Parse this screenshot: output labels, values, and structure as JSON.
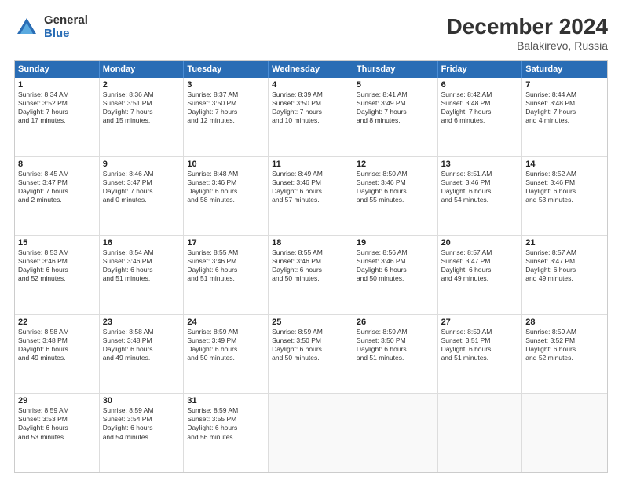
{
  "logo": {
    "general": "General",
    "blue": "Blue"
  },
  "title": "December 2024",
  "subtitle": "Balakirevo, Russia",
  "weekdays": [
    "Sunday",
    "Monday",
    "Tuesday",
    "Wednesday",
    "Thursday",
    "Friday",
    "Saturday"
  ],
  "weeks": [
    [
      {
        "day": "1",
        "text": "Sunrise: 8:34 AM\nSunset: 3:52 PM\nDaylight: 7 hours\nand 17 minutes."
      },
      {
        "day": "2",
        "text": "Sunrise: 8:36 AM\nSunset: 3:51 PM\nDaylight: 7 hours\nand 15 minutes."
      },
      {
        "day": "3",
        "text": "Sunrise: 8:37 AM\nSunset: 3:50 PM\nDaylight: 7 hours\nand 12 minutes."
      },
      {
        "day": "4",
        "text": "Sunrise: 8:39 AM\nSunset: 3:50 PM\nDaylight: 7 hours\nand 10 minutes."
      },
      {
        "day": "5",
        "text": "Sunrise: 8:41 AM\nSunset: 3:49 PM\nDaylight: 7 hours\nand 8 minutes."
      },
      {
        "day": "6",
        "text": "Sunrise: 8:42 AM\nSunset: 3:48 PM\nDaylight: 7 hours\nand 6 minutes."
      },
      {
        "day": "7",
        "text": "Sunrise: 8:44 AM\nSunset: 3:48 PM\nDaylight: 7 hours\nand 4 minutes."
      }
    ],
    [
      {
        "day": "8",
        "text": "Sunrise: 8:45 AM\nSunset: 3:47 PM\nDaylight: 7 hours\nand 2 minutes."
      },
      {
        "day": "9",
        "text": "Sunrise: 8:46 AM\nSunset: 3:47 PM\nDaylight: 7 hours\nand 0 minutes."
      },
      {
        "day": "10",
        "text": "Sunrise: 8:48 AM\nSunset: 3:46 PM\nDaylight: 6 hours\nand 58 minutes."
      },
      {
        "day": "11",
        "text": "Sunrise: 8:49 AM\nSunset: 3:46 PM\nDaylight: 6 hours\nand 57 minutes."
      },
      {
        "day": "12",
        "text": "Sunrise: 8:50 AM\nSunset: 3:46 PM\nDaylight: 6 hours\nand 55 minutes."
      },
      {
        "day": "13",
        "text": "Sunrise: 8:51 AM\nSunset: 3:46 PM\nDaylight: 6 hours\nand 54 minutes."
      },
      {
        "day": "14",
        "text": "Sunrise: 8:52 AM\nSunset: 3:46 PM\nDaylight: 6 hours\nand 53 minutes."
      }
    ],
    [
      {
        "day": "15",
        "text": "Sunrise: 8:53 AM\nSunset: 3:46 PM\nDaylight: 6 hours\nand 52 minutes."
      },
      {
        "day": "16",
        "text": "Sunrise: 8:54 AM\nSunset: 3:46 PM\nDaylight: 6 hours\nand 51 minutes."
      },
      {
        "day": "17",
        "text": "Sunrise: 8:55 AM\nSunset: 3:46 PM\nDaylight: 6 hours\nand 51 minutes."
      },
      {
        "day": "18",
        "text": "Sunrise: 8:55 AM\nSunset: 3:46 PM\nDaylight: 6 hours\nand 50 minutes."
      },
      {
        "day": "19",
        "text": "Sunrise: 8:56 AM\nSunset: 3:46 PM\nDaylight: 6 hours\nand 50 minutes."
      },
      {
        "day": "20",
        "text": "Sunrise: 8:57 AM\nSunset: 3:47 PM\nDaylight: 6 hours\nand 49 minutes."
      },
      {
        "day": "21",
        "text": "Sunrise: 8:57 AM\nSunset: 3:47 PM\nDaylight: 6 hours\nand 49 minutes."
      }
    ],
    [
      {
        "day": "22",
        "text": "Sunrise: 8:58 AM\nSunset: 3:48 PM\nDaylight: 6 hours\nand 49 minutes."
      },
      {
        "day": "23",
        "text": "Sunrise: 8:58 AM\nSunset: 3:48 PM\nDaylight: 6 hours\nand 49 minutes."
      },
      {
        "day": "24",
        "text": "Sunrise: 8:59 AM\nSunset: 3:49 PM\nDaylight: 6 hours\nand 50 minutes."
      },
      {
        "day": "25",
        "text": "Sunrise: 8:59 AM\nSunset: 3:50 PM\nDaylight: 6 hours\nand 50 minutes."
      },
      {
        "day": "26",
        "text": "Sunrise: 8:59 AM\nSunset: 3:50 PM\nDaylight: 6 hours\nand 51 minutes."
      },
      {
        "day": "27",
        "text": "Sunrise: 8:59 AM\nSunset: 3:51 PM\nDaylight: 6 hours\nand 51 minutes."
      },
      {
        "day": "28",
        "text": "Sunrise: 8:59 AM\nSunset: 3:52 PM\nDaylight: 6 hours\nand 52 minutes."
      }
    ],
    [
      {
        "day": "29",
        "text": "Sunrise: 8:59 AM\nSunset: 3:53 PM\nDaylight: 6 hours\nand 53 minutes."
      },
      {
        "day": "30",
        "text": "Sunrise: 8:59 AM\nSunset: 3:54 PM\nDaylight: 6 hours\nand 54 minutes."
      },
      {
        "day": "31",
        "text": "Sunrise: 8:59 AM\nSunset: 3:55 PM\nDaylight: 6 hours\nand 56 minutes."
      },
      {
        "day": "",
        "text": ""
      },
      {
        "day": "",
        "text": ""
      },
      {
        "day": "",
        "text": ""
      },
      {
        "day": "",
        "text": ""
      }
    ]
  ]
}
